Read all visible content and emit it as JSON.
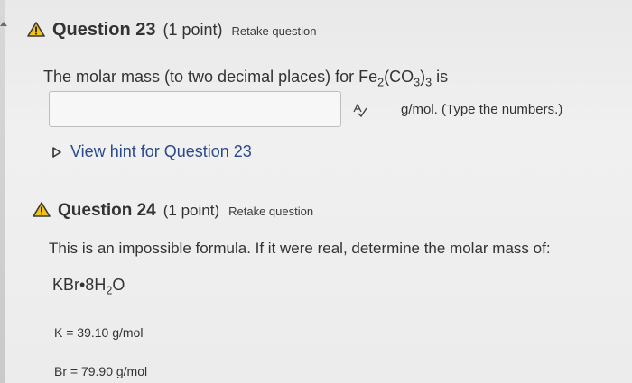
{
  "question23": {
    "title": "Question 23",
    "points": "(1 point)",
    "retake": "Retake question",
    "text_prefix": "The molar mass (to two decimal places) for Fe",
    "formula_sub1": "2",
    "formula_mid": "(CO",
    "formula_sub2": "3",
    "formula_close": ")",
    "formula_sub3": "3",
    "text_suffix": " is",
    "answer_value": "",
    "unit_label": "g/mol. (Type the numbers.)",
    "hint_label": "View hint for Question 23"
  },
  "question24": {
    "title": "Question 24",
    "points": "(1 point)",
    "retake": "Retake question",
    "text": "This is an impossible formula.  If it were real, determine the molar mass of:",
    "formula_main": "KBr•8H",
    "formula_sub": "2",
    "formula_end": "O",
    "masses": [
      {
        "label": "K = 39.10 g/mol"
      },
      {
        "label": "Br = 79.90 g/mol"
      }
    ]
  },
  "icons": {
    "warning": "warning-triangle-icon",
    "spellcheck": "spellcheck-icon",
    "hint": "play-triangle-icon"
  },
  "colors": {
    "warning_yellow": "#f2c21b",
    "hint_link": "#2b4a8a"
  }
}
